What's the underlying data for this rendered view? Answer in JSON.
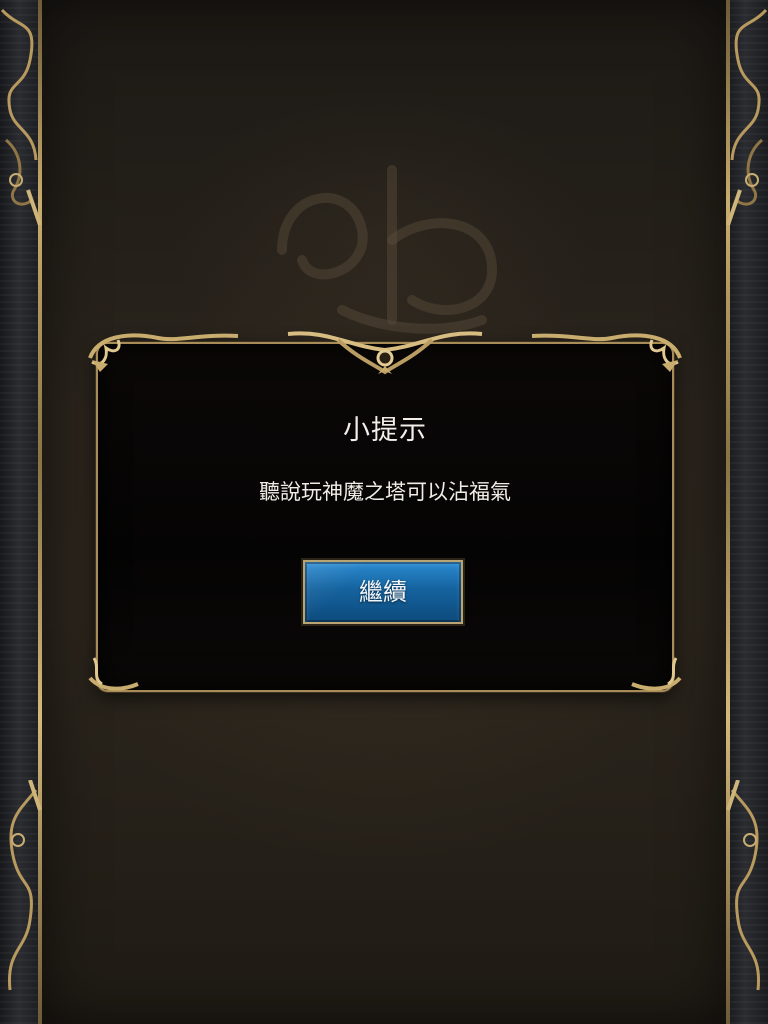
{
  "dialog": {
    "title": "小提示",
    "message": "聽說玩神魔之塔可以沾福氣",
    "continue_label": "繼續"
  },
  "colors": {
    "frame_gold": "#a78c58",
    "button_blue": "#1a6fae",
    "panel_brown": "#2a241c",
    "dialog_black": "#050404",
    "text_white": "#f2efe8"
  },
  "icons": [
    "background-emblem-icon",
    "ornate-frame-corner-icon",
    "scrollwork-icon"
  ]
}
